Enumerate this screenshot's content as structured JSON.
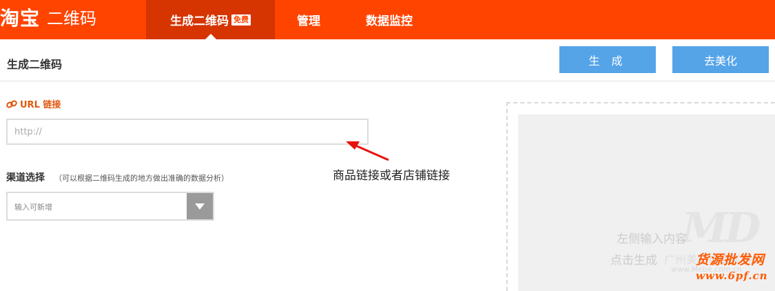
{
  "header": {
    "logo_main": "淘宝",
    "logo_sub": "二维码",
    "tabs": [
      {
        "label": "生成二维码",
        "badge": "免费"
      },
      {
        "label": "管理"
      },
      {
        "label": "数据监控"
      }
    ]
  },
  "page": {
    "title": "生成二维码",
    "generate_button": "生 成",
    "beautify_button": "去美化"
  },
  "url_section": {
    "label": "URL 链接",
    "placeholder": "http://",
    "annotation": "商品链接或者店铺链接"
  },
  "channel": {
    "label": "渠道选择",
    "hint": "（可以根据二维码生成的地方做出准确的数据分析）",
    "select_placeholder": "输入可新增"
  },
  "preview": {
    "line1": "左侧输入内容",
    "line2": "点击生成",
    "watermark_logo": "MD",
    "watermark_company": "广州美迪电商学院",
    "watermark_site": "www.Mebe.com.cn",
    "watermark_red": "货源批发网",
    "watermark_url": "www.6pf.cn"
  },
  "colors": {
    "brand": "#ff4400",
    "active_tab": "#d63400",
    "button": "#55a4e8",
    "link_label": "#e0580f"
  }
}
